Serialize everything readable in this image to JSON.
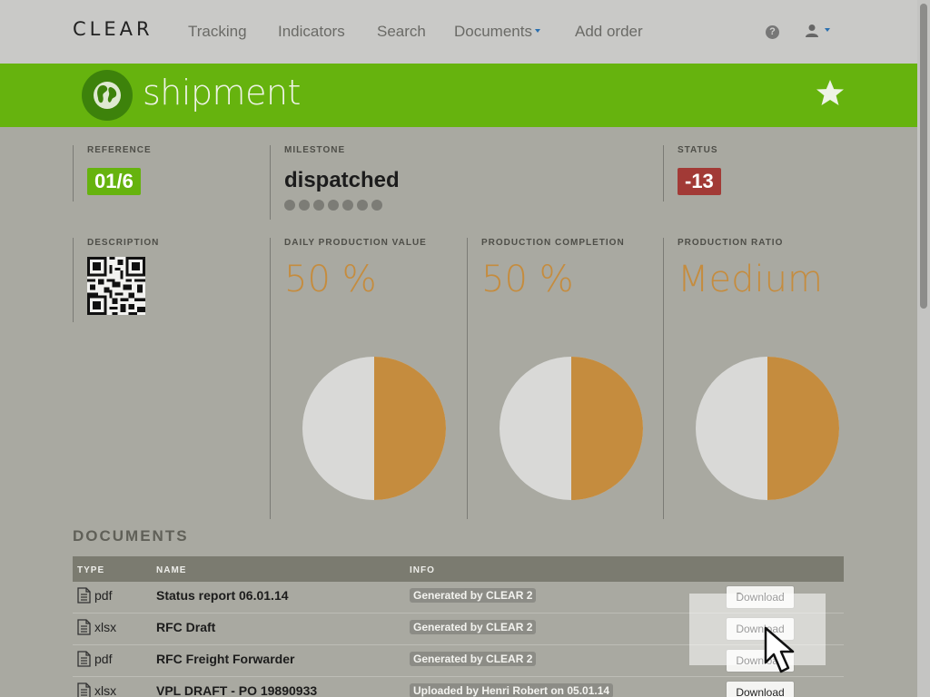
{
  "nav": {
    "logo": "CLEAR",
    "items": [
      {
        "label": "Tracking"
      },
      {
        "label": "Indicators"
      },
      {
        "label": "Search"
      },
      {
        "label": "Documents",
        "has_caret": true
      },
      {
        "label": "Add order"
      }
    ],
    "help_icon": "question-circle-icon",
    "user_icon": "user-icon"
  },
  "banner": {
    "title": "shipment",
    "icon": "globe-icon",
    "star_icon": "star-icon",
    "color": "#66b30e"
  },
  "reference": {
    "label": "REFERENCE",
    "value": "01/6",
    "color": "#66b30e"
  },
  "milestone": {
    "label": "MILESTONE",
    "value": "dispatched",
    "dots_total": 7
  },
  "status": {
    "label": "STATUS",
    "value": "-13",
    "color": "#a23a36"
  },
  "description": {
    "label": "DESCRIPTION",
    "icon": "qr-code-icon"
  },
  "metrics": [
    {
      "label": "DAILY PRODUCTION VALUE",
      "value": "50 %",
      "fraction": 0.5
    },
    {
      "label": "PRODUCTION COMPLETION",
      "value": "50 %",
      "fraction": 0.5
    },
    {
      "label": "PRODUCTION RATIO",
      "value": "Medium",
      "fraction": 0.5
    }
  ],
  "pie_colors": {
    "filled": "#c58c3e",
    "empty": "#d9d9d7"
  },
  "documents": {
    "title": "DOCUMENTS",
    "columns": [
      "TYPE",
      "NAME",
      "INFO"
    ],
    "button_label": "Download",
    "rows": [
      {
        "type": "pdf",
        "name": "Status report 06.01.14",
        "info": "Generated by CLEAR 2"
      },
      {
        "type": "xlsx",
        "name": "RFC Draft",
        "info": "Generated by CLEAR 2"
      },
      {
        "type": "pdf",
        "name": "RFC Freight Forwarder",
        "info": "Generated by CLEAR 2"
      },
      {
        "type": "xlsx",
        "name": "VPL DRAFT - PO 19890933",
        "info": "Uploaded by Henri Robert on 05.01.14"
      }
    ]
  }
}
